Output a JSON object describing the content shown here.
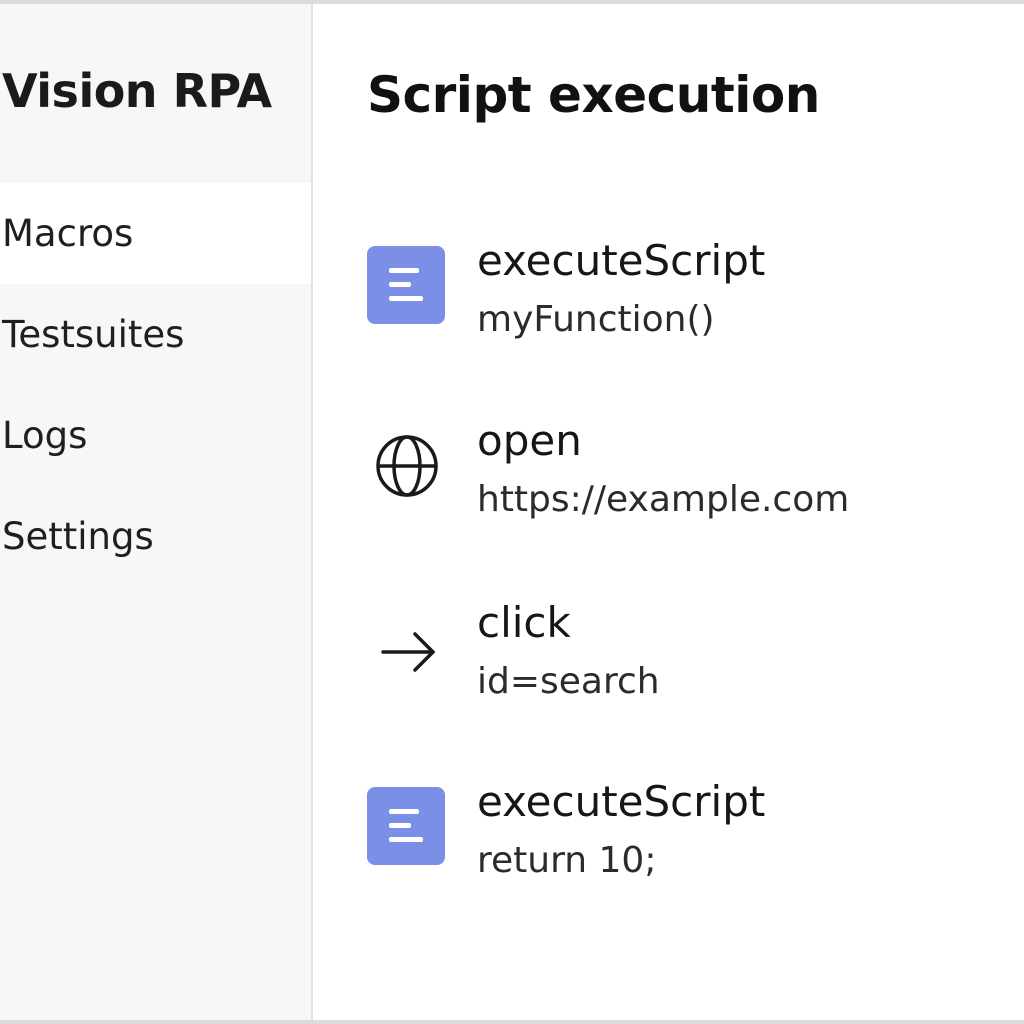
{
  "sidebar": {
    "brand": "Vision RPA",
    "items": [
      {
        "label": "Macros",
        "active": true
      },
      {
        "label": "Testsuites",
        "active": false
      },
      {
        "label": "Logs",
        "active": false
      },
      {
        "label": "Settings",
        "active": false
      }
    ]
  },
  "main": {
    "title": "Script execution",
    "commands": [
      {
        "icon": "script-icon",
        "name": "executeScript",
        "target": "myFunction()"
      },
      {
        "icon": "globe-icon",
        "name": "open",
        "target": "https://example.com"
      },
      {
        "icon": "arrow-right-icon",
        "name": "click",
        "target": "id=search"
      },
      {
        "icon": "script-icon",
        "name": "executeScript",
        "target": "return 10;"
      }
    ]
  },
  "colors": {
    "accent": "#7b8fe6",
    "sidebar_bg": "#f7f7f7",
    "active_item_bg": "#ffffff"
  }
}
